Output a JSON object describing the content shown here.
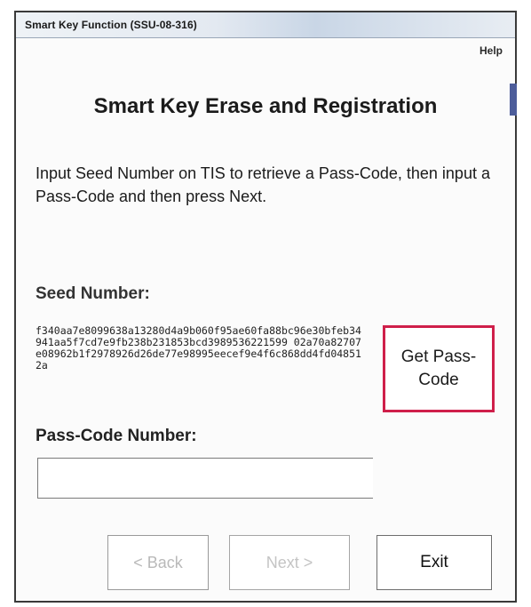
{
  "window": {
    "title": "Smart Key Function (SSU-08-316)",
    "help_label": "Help"
  },
  "main": {
    "heading": "Smart Key Erase and Registration",
    "instructions": "Input Seed Number on TIS to retrieve a Pass-Code, then input a Pass-Code and then press Next.",
    "seed_label": "Seed Number:",
    "seed_value": "f340aa7e8099638a13280d4a9b060f95ae60fa88bc96e30bfeb34941aa5f7cd7e9fb238b231853bcd3989536221599 02a70a82707e08962b1f2978926d26de77e98995eecef9e4f6c868dd4fd048512a",
    "get_pass_label": "Get Pass-Code",
    "pass_label": "Pass-Code Number:",
    "pass_value": ""
  },
  "buttons": {
    "back": "< Back",
    "next": "Next >",
    "exit": "Exit"
  },
  "colors": {
    "highlight_border": "#cf1f4a",
    "disabled_text": "#b9b9b9"
  }
}
